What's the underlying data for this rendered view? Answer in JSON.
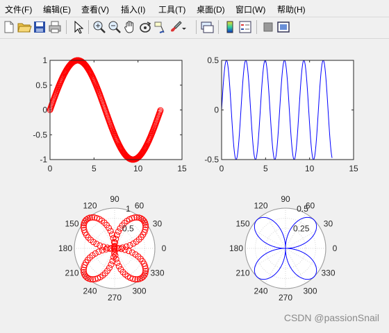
{
  "menu": [
    {
      "label": "文件(F)"
    },
    {
      "label": "编辑(E)"
    },
    {
      "label": "查看(V)"
    },
    {
      "label": "插入(I)"
    },
    {
      "label": "工具(T)"
    },
    {
      "label": "桌面(D)"
    },
    {
      "label": "窗口(W)"
    },
    {
      "label": "帮助(H)"
    }
  ],
  "toolbar": {
    "icons": [
      "new-file-icon",
      "open-folder-icon",
      "save-icon",
      "print-icon",
      "pointer-icon",
      "zoom-in-icon",
      "zoom-out-icon",
      "pan-hand-icon",
      "rotate-3d-icon",
      "data-cursor-icon",
      "brush-icon",
      "brush-dropdown-icon",
      "link-plot-icon",
      "colorbar-icon",
      "legend-icon",
      "hide-plot-tools-icon",
      "show-plot-tools-icon"
    ]
  },
  "watermark": "CSDN @passionSnail",
  "colors": {
    "red": "#ff0000",
    "blue": "#0000ff",
    "axes_bg": "#ffffff",
    "figure_bg": "#f0f0f0"
  },
  "chart_data": [
    {
      "type": "scatter",
      "marker": "circle",
      "color": "#ff0000",
      "expression": "y = sin(x/2), x from 0 to 4*pi step 0.05",
      "x_range": [
        0,
        12.57
      ],
      "xlim": [
        0,
        15
      ],
      "ylim": [
        -1,
        1
      ],
      "xticks": [
        "0",
        "5",
        "10",
        "15"
      ],
      "yticks": [
        "1",
        "0.5",
        "0",
        "-0.5",
        "-1"
      ],
      "grid": false
    },
    {
      "type": "line",
      "color": "#0000ff",
      "expression": "y = sin(x)^2 * ... shown as sinusoid between -0.5 and 0.5 with period ~2.2",
      "x_range": [
        0,
        12.57
      ],
      "period": 2.2,
      "xlim": [
        0,
        15
      ],
      "ylim": [
        -0.5,
        0.5
      ],
      "xticks": [
        "0",
        "5",
        "10",
        "15"
      ],
      "yticks": [
        "0.5",
        "0",
        "-0.5"
      ],
      "grid": false
    },
    {
      "type": "polar",
      "marker": "circle",
      "color": "#ff0000",
      "expression": "r = |sin(2θ)| style four-fold rose with circular lobes",
      "rlim": [
        0,
        1
      ],
      "rticks": [
        "0.5",
        "1"
      ],
      "angle_labels": [
        "0",
        "30",
        "60",
        "90",
        "120",
        "150",
        "180",
        "210",
        "240",
        "270",
        "300",
        "330"
      ]
    },
    {
      "type": "polar",
      "color": "#0000ff",
      "expression": "r = 0.5*|sin(2θ)| four-petal rose",
      "rlim": [
        0,
        0.5
      ],
      "rticks": [
        "0.25",
        "0.5"
      ],
      "angle_labels": [
        "0",
        "30",
        "60",
        "90",
        "120",
        "150",
        "180",
        "210",
        "240",
        "270",
        "300",
        "330"
      ]
    }
  ]
}
